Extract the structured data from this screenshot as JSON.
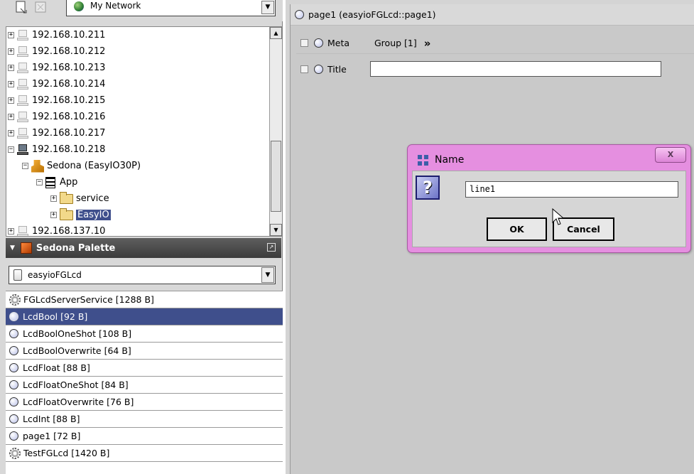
{
  "nav": {
    "network_combo": "My Network",
    "tree": [
      {
        "label": "192.168.10.211",
        "expander": "+",
        "icon": "pc-icon",
        "indent": 0
      },
      {
        "label": "192.168.10.212",
        "expander": "+",
        "icon": "pc-icon",
        "indent": 0
      },
      {
        "label": "192.168.10.213",
        "expander": "+",
        "icon": "pc-icon",
        "indent": 0
      },
      {
        "label": "192.168.10.214",
        "expander": "+",
        "icon": "pc-icon",
        "indent": 0
      },
      {
        "label": "192.168.10.215",
        "expander": "+",
        "icon": "pc-icon",
        "indent": 0
      },
      {
        "label": "192.168.10.216",
        "expander": "+",
        "icon": "pc-icon",
        "indent": 0
      },
      {
        "label": "192.168.10.217",
        "expander": "+",
        "icon": "pc-icon",
        "indent": 0
      },
      {
        "label": "192.168.10.218",
        "expander": "−",
        "icon": "pc-dark-icon",
        "indent": 0
      },
      {
        "label": "Sedona (EasyIO30P)",
        "expander": "−",
        "icon": "sedona-icon",
        "indent": 1
      },
      {
        "label": "App",
        "expander": "−",
        "icon": "app-icon",
        "indent": 2
      },
      {
        "label": "service",
        "expander": "+",
        "icon": "folder-icon",
        "indent": 3
      },
      {
        "label": "EasyIO",
        "expander": "+",
        "icon": "folder-icon",
        "indent": 3,
        "selected": true
      },
      {
        "label": "192.168.137.10",
        "expander": "+",
        "icon": "pc-icon",
        "indent": 0
      }
    ]
  },
  "palette": {
    "header": "Sedona Palette",
    "kit_combo": "easyioFGLcd",
    "items": [
      {
        "label": "FGLcdServerService [1288 B]",
        "icon": "gear-icon"
      },
      {
        "label": "LcdBool [92 B]",
        "icon": "component-icon",
        "selected": true
      },
      {
        "label": "LcdBoolOneShot [108 B]",
        "icon": "component-icon"
      },
      {
        "label": "LcdBoolOverwrite [64 B]",
        "icon": "component-icon"
      },
      {
        "label": "LcdFloat [88 B]",
        "icon": "component-icon"
      },
      {
        "label": "LcdFloatOneShot [84 B]",
        "icon": "component-icon"
      },
      {
        "label": "LcdFloatOverwrite [76 B]",
        "icon": "component-icon"
      },
      {
        "label": "LcdInt [88 B]",
        "icon": "component-icon"
      },
      {
        "label": "page1 [72 B]",
        "icon": "component-icon"
      },
      {
        "label": "TestFGLcd [1420 B]",
        "icon": "gear-icon"
      }
    ]
  },
  "property_sheet": {
    "title": "page1  (easyioFGLcd::page1)",
    "meta_label": "Meta",
    "meta_value": "Group [1]",
    "meta_chevron": "»",
    "title_label": "Title",
    "title_value": ""
  },
  "dialog": {
    "title": "Name",
    "close_glyph": "X",
    "question_glyph": "?",
    "input_value": "line1",
    "ok_label": "OK",
    "cancel_label": "Cancel"
  },
  "colors": {
    "selection": "#3f4f8c",
    "dialog_frame": "#e58fe0",
    "palette_header": "#4a4a4a"
  }
}
